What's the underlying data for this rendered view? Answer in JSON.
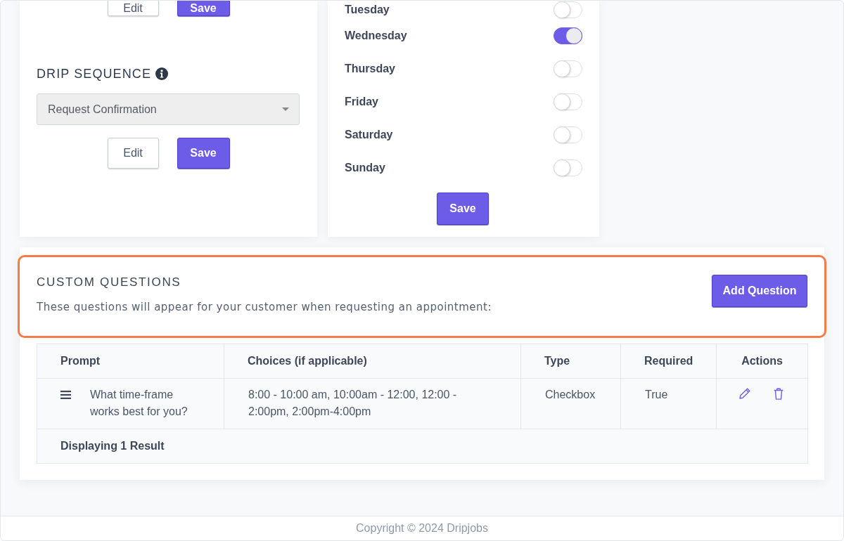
{
  "drip_sequence": {
    "top_buttons": [
      {
        "label": "Edit",
        "kind": "outline"
      },
      {
        "label": "Save",
        "kind": "primary"
      }
    ],
    "heading": "DRIP SEQUENCE",
    "select": {
      "value": "Request Confirmation"
    },
    "buttons": [
      {
        "label": "Edit",
        "kind": "outline"
      },
      {
        "label": "Save",
        "kind": "primary"
      }
    ]
  },
  "schedule": {
    "days": [
      {
        "label": "Tuesday",
        "on": false
      },
      {
        "label": "Wednesday",
        "on": true
      },
      {
        "label": "Thursday",
        "on": false
      },
      {
        "label": "Friday",
        "on": false
      },
      {
        "label": "Saturday",
        "on": false
      },
      {
        "label": "Sunday",
        "on": false
      }
    ],
    "save_button": {
      "label": "Save",
      "kind": "primary"
    }
  },
  "custom_questions": {
    "highlighted": true,
    "title": "CUSTOM QUESTIONS",
    "description": "These questions will appear for your customer when requesting an appointment:",
    "add_button": {
      "label": "Add Question",
      "kind": "primary"
    },
    "table": {
      "columns": [
        "Prompt",
        "Choices (if applicable)",
        "Type",
        "Required",
        "Actions"
      ],
      "rows": [
        {
          "prompt": "What time-frame works best for you?",
          "choices": "8:00 - 10:00 am, 10:00am - 12:00, 12:00 - 2:00pm, 2:00pm-4:00pm",
          "type": "Checkbox",
          "required": "True"
        }
      ],
      "footer": "Displaying 1 Result"
    }
  },
  "footer": {
    "copyright": "Copyright © 2024 Dripjobs"
  }
}
